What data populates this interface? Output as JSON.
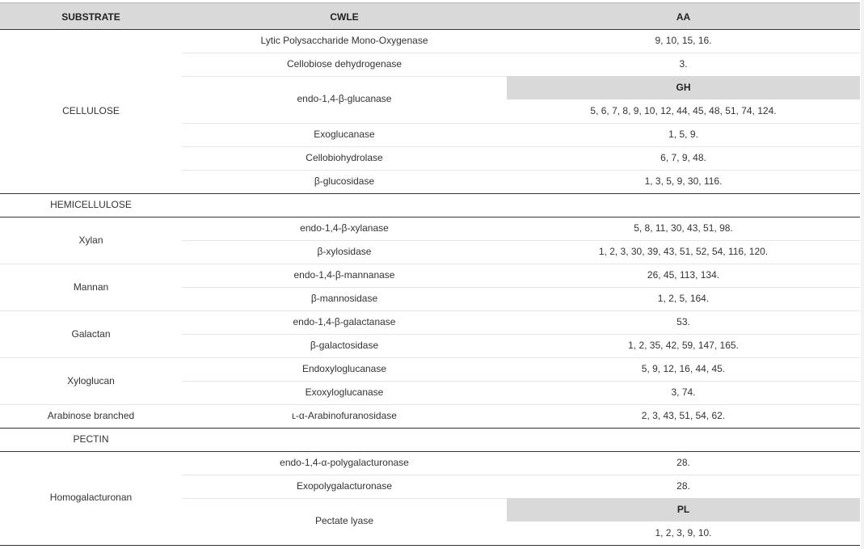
{
  "header": {
    "substrate": "SUBSTRATE",
    "cwle": "CWLE",
    "aa": "AA"
  },
  "cellulose": {
    "substrate": "CELLULOSE",
    "rows": [
      {
        "cwle": "Lytic Polysaccharide Mono-Oxygenase",
        "aa": "9, 10, 15, 16."
      },
      {
        "cwle": "Cellobiose dehydrogenase",
        "aa": "3."
      },
      {
        "cwle": "endo-1,4-β-glucanase",
        "gh_label": "GH",
        "aa": "5, 6, 7, 8, 9, 10, 12, 44, 45, 48, 51, 74, 124."
      },
      {
        "cwle": "Exoglucanase",
        "aa": "1, 5, 9."
      },
      {
        "cwle": "Cellobiohydrolase",
        "aa": "6, 7, 9, 48."
      },
      {
        "cwle": "β-glucosidase",
        "aa": "1, 3, 5, 9, 30, 116."
      }
    ]
  },
  "hemicellulose": {
    "label": "HEMICELLULOSE",
    "xylan": {
      "substrate": "Xylan",
      "rows": [
        {
          "cwle": "endo-1,4-β-xylanase",
          "aa": "5, 8, 11, 30, 43, 51, 98."
        },
        {
          "cwle": "β-xylosidase",
          "aa": "1, 2, 3, 30, 39, 43, 51, 52, 54, 116, 120."
        }
      ]
    },
    "mannan": {
      "substrate": "Mannan",
      "rows": [
        {
          "cwle": "endo-1,4-β-mannanase",
          "aa": "26, 45, 113, 134."
        },
        {
          "cwle": "β-mannosidase",
          "aa": "1, 2, 5, 164."
        }
      ]
    },
    "galactan": {
      "substrate": "Galactan",
      "rows": [
        {
          "cwle": "endo-1,4-β-galactanase",
          "aa": "53."
        },
        {
          "cwle": "β-galactosidase",
          "aa": "1, 2, 35, 42, 59, 147, 165."
        }
      ]
    },
    "xyloglucan": {
      "substrate": "Xyloglucan",
      "rows": [
        {
          "cwle": "Endoxyloglucanase",
          "aa": "5, 9, 12, 16, 44, 45."
        },
        {
          "cwle": "Exoxyloglucanase",
          "aa": "3, 74."
        }
      ]
    },
    "arabinose": {
      "substrate": "Arabinose branched",
      "rows": [
        {
          "cwle": "ʟ-α-Arabinofuranosidase",
          "aa": "2, 3, 43, 51, 54, 62."
        }
      ]
    }
  },
  "pectin": {
    "label": "PECTIN",
    "homogalacturonan": {
      "substrate": "Homogalacturonan",
      "rows": [
        {
          "cwle": "endo-1,4-α-polygalacturonase",
          "aa": "28."
        },
        {
          "cwle": "Exopolygalacturonase",
          "aa": "28."
        },
        {
          "cwle": "Pectate lyase",
          "pl_label": "PL",
          "aa": "1, 2, 3, 9, 10."
        }
      ]
    }
  }
}
